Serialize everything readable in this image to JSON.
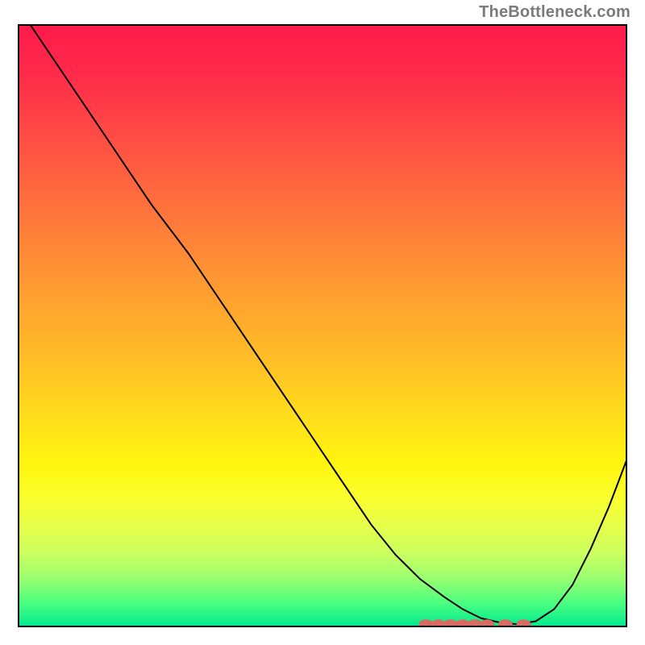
{
  "watermark": "TheBottleneck.com",
  "chart_data": {
    "type": "line",
    "title": "",
    "xlabel": "",
    "ylabel": "",
    "xlim": [
      0,
      100
    ],
    "ylim": [
      0,
      100
    ],
    "series": [
      {
        "name": "curve",
        "x": [
          0,
          6,
          12,
          18,
          22,
          28,
          34,
          40,
          46,
          52,
          58,
          62,
          66,
          70,
          73,
          76,
          79,
          82,
          85,
          88,
          91,
          94,
          97,
          100
        ],
        "y": [
          103,
          94,
          85,
          76,
          70,
          62,
          53,
          44,
          35,
          26,
          17,
          12,
          8,
          5,
          3,
          1.5,
          0.8,
          0.5,
          1,
          3,
          7,
          13,
          20,
          28
        ]
      }
    ],
    "markers": {
      "name": "data-points",
      "shape": "pill",
      "color": "#d86b64",
      "points": [
        {
          "x": 67,
          "y": 0.5
        },
        {
          "x": 69,
          "y": 0.5
        },
        {
          "x": 71,
          "y": 0.5
        },
        {
          "x": 73,
          "y": 0.5
        },
        {
          "x": 75,
          "y": 0.5
        },
        {
          "x": 77,
          "y": 0.5
        },
        {
          "x": 80,
          "y": 0.5
        },
        {
          "x": 83,
          "y": 0.5
        }
      ]
    }
  }
}
